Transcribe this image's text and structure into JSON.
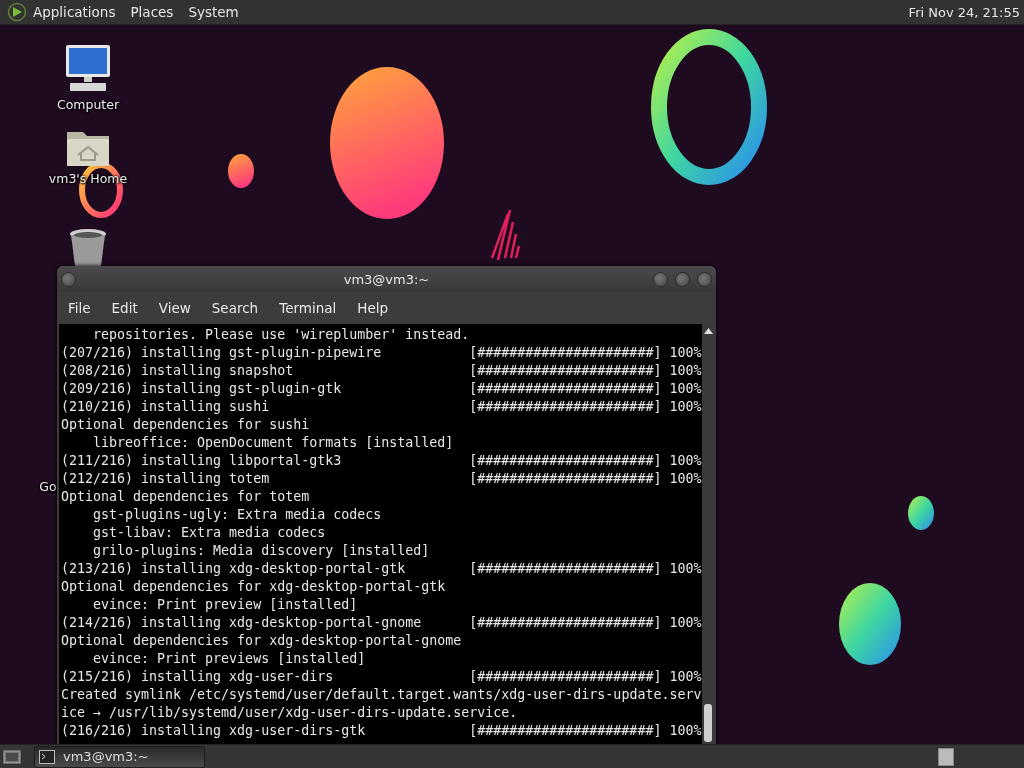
{
  "top_panel": {
    "menus": [
      "Applications",
      "Places",
      "System"
    ],
    "clock": "Fri Nov 24, 21:55"
  },
  "desktop_icons": [
    {
      "kind": "computer",
      "label": "Computer"
    },
    {
      "kind": "home",
      "label": "vm3's Home"
    },
    {
      "kind": "trash"
    },
    {
      "kind": "hidden",
      "label": "Go"
    }
  ],
  "terminal": {
    "title": "vm3@vm3:~",
    "menus": [
      "File",
      "Edit",
      "View",
      "Search",
      "Terminal",
      "Help"
    ],
    "lines": [
      {
        "kind": "text",
        "text": "    repositories. Please use 'wireplumber' instead."
      },
      {
        "kind": "progress",
        "text": "(207/216) installing gst-plugin-pipewire",
        "bar": "[######################]",
        "percent": "100%"
      },
      {
        "kind": "progress",
        "text": "(208/216) installing snapshot",
        "bar": "[######################]",
        "percent": "100%"
      },
      {
        "kind": "progress",
        "text": "(209/216) installing gst-plugin-gtk",
        "bar": "[######################]",
        "percent": "100%"
      },
      {
        "kind": "progress",
        "text": "(210/216) installing sushi",
        "bar": "[######################]",
        "percent": "100%"
      },
      {
        "kind": "text",
        "text": "Optional dependencies for sushi"
      },
      {
        "kind": "text",
        "text": "    libreoffice: OpenDocument formats [installed]"
      },
      {
        "kind": "progress",
        "text": "(211/216) installing libportal-gtk3",
        "bar": "[######################]",
        "percent": "100%"
      },
      {
        "kind": "progress",
        "text": "(212/216) installing totem",
        "bar": "[######################]",
        "percent": "100%"
      },
      {
        "kind": "text",
        "text": "Optional dependencies for totem"
      },
      {
        "kind": "text",
        "text": "    gst-plugins-ugly: Extra media codecs"
      },
      {
        "kind": "text",
        "text": "    gst-libav: Extra media codecs"
      },
      {
        "kind": "text",
        "text": "    grilo-plugins: Media discovery [installed]"
      },
      {
        "kind": "progress",
        "text": "(213/216) installing xdg-desktop-portal-gtk",
        "bar": "[######################]",
        "percent": "100%"
      },
      {
        "kind": "text",
        "text": "Optional dependencies for xdg-desktop-portal-gtk"
      },
      {
        "kind": "text",
        "text": "    evince: Print preview [installed]"
      },
      {
        "kind": "progress",
        "text": "(214/216) installing xdg-desktop-portal-gnome",
        "bar": "[######################]",
        "percent": "100%"
      },
      {
        "kind": "text",
        "text": "Optional dependencies for xdg-desktop-portal-gnome"
      },
      {
        "kind": "text",
        "text": "    evince: Print previews [installed]"
      },
      {
        "kind": "progress",
        "text": "(215/216) installing xdg-user-dirs",
        "bar": "[######################]",
        "percent": "100%"
      },
      {
        "kind": "text",
        "text": "Created symlink /etc/systemd/user/default.target.wants/xdg-user-dirs-update.serv"
      },
      {
        "kind": "text",
        "text": "ice → /usr/lib/systemd/user/xdg-user-dirs-update.service."
      },
      {
        "kind": "progress",
        "text": "(216/216) installing xdg-user-dirs-gtk",
        "bar": "[######################]",
        "percent": "100%"
      }
    ]
  },
  "taskbar": {
    "tasks": [
      {
        "label": "vm3@vm3:~",
        "selected": true
      }
    ]
  }
}
